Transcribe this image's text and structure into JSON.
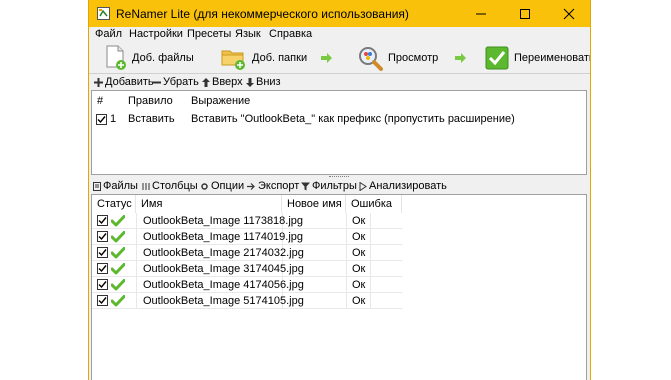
{
  "window": {
    "title": "ReNamer Lite (для некоммерческого использования)"
  },
  "menu": [
    "Файл",
    "Настройки",
    "Пресеты",
    "Язык",
    "Справка"
  ],
  "toolbar": {
    "add_files": "Доб. файлы",
    "add_folders": "Доб. папки",
    "preview": "Просмотр",
    "rename": "Переименовать"
  },
  "rules_toolbar": {
    "add": "Добавить",
    "remove": "Убрать",
    "up": "Вверх",
    "down": "Вниз"
  },
  "rules_table": {
    "headers": [
      "#",
      "Правило",
      "Выражение"
    ],
    "rows": [
      {
        "num": "1",
        "rule": "Вставить",
        "expression": "Вставить \"OutlookBeta_\" как префикс (пропустить расширение)",
        "checked": true
      }
    ]
  },
  "files_toolbar": {
    "files": "Файлы",
    "columns": "Столбцы",
    "options": "Опции",
    "export": "Экспорт",
    "filters": "Фильтры",
    "analyze": "Анализировать"
  },
  "files_table": {
    "headers": [
      "Статус",
      "Имя",
      "Новое имя",
      "Ошибка"
    ],
    "rows": [
      {
        "name": "OutlookBeta_Image 1173818.jpg",
        "new_name": "",
        "error": "Ок"
      },
      {
        "name": "OutlookBeta_Image 1174019.jpg",
        "new_name": "",
        "error": "Ок"
      },
      {
        "name": "OutlookBeta_Image 2174032.jpg",
        "new_name": "",
        "error": "Ок"
      },
      {
        "name": "OutlookBeta_Image 3174045.jpg",
        "new_name": "",
        "error": "Ок"
      },
      {
        "name": "OutlookBeta_Image 4174056.jpg",
        "new_name": "",
        "error": "Ок"
      },
      {
        "name": "OutlookBeta_Image 5174105.jpg",
        "new_name": "",
        "error": "Ок"
      }
    ]
  },
  "colors": {
    "titlebar": "#f9c10a",
    "check_green": "#5cb82e",
    "arrow_green": "#7ac943"
  }
}
